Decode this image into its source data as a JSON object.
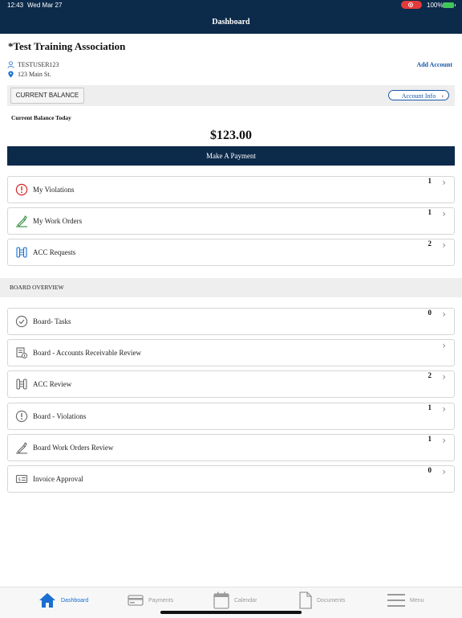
{
  "status_bar": {
    "time": "12:43",
    "date": "Wed Mar 27",
    "battery": "100%"
  },
  "nav": {
    "title": "Dashboard"
  },
  "account": {
    "org_name": "*Test Training Association",
    "user": "TESTUSER123",
    "address": "123 Main St.",
    "add_account": "Add Account"
  },
  "balance": {
    "tab_label": "CURRENT BALANCE",
    "account_info": "Account Info",
    "today_label": "Current Balance Today",
    "amount": "$123.00",
    "pay_button": "Make A Payment"
  },
  "items": [
    {
      "label": "My Violations",
      "count": "1",
      "icon": "alert-icon",
      "color": "#d62828"
    },
    {
      "label": "My Work Orders",
      "count": "1",
      "icon": "work-order-icon",
      "color": "#2e8b3a"
    },
    {
      "label": "ACC Requests",
      "count": "2",
      "icon": "acc-icon",
      "color": "#1a6fd1"
    }
  ],
  "board": {
    "title": "BOARD OVERVIEW",
    "items": [
      {
        "label": "Board- Tasks",
        "count": "0",
        "icon": "check-circle-icon"
      },
      {
        "label": "Board - Accounts Receivable Review",
        "count": "",
        "icon": "receivable-icon"
      },
      {
        "label": "ACC Review",
        "count": "2",
        "icon": "acc-icon"
      },
      {
        "label": "Board - Violations",
        "count": "1",
        "icon": "alert-icon"
      },
      {
        "label": "Board Work Orders Review",
        "count": "1",
        "icon": "work-order-icon"
      },
      {
        "label": "Invoice Approval",
        "count": "0",
        "icon": "invoice-icon"
      }
    ]
  },
  "tabs": [
    {
      "label": "Dashboard",
      "icon": "home-icon",
      "active": true
    },
    {
      "label": "Payments",
      "icon": "card-icon"
    },
    {
      "label": "Calendar",
      "icon": "calendar-icon"
    },
    {
      "label": "Documents",
      "icon": "document-icon"
    },
    {
      "label": "Menu",
      "icon": "menu-icon"
    }
  ],
  "colors": {
    "navy": "#0c2a4a",
    "accent": "#1a5aa8",
    "active_tab": "#1a6fd1"
  }
}
